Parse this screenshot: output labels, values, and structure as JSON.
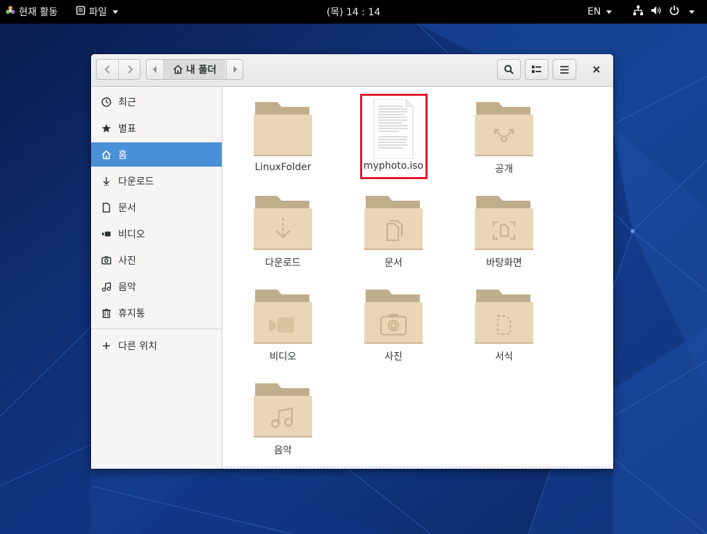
{
  "topbar": {
    "activities": "현재 활동",
    "app_name": "파일",
    "clock": "(목) 14 : 14",
    "language": "EN"
  },
  "window": {
    "breadcrumb_home": "내 폴더"
  },
  "sidebar": {
    "items": [
      {
        "label": "최근",
        "icon": "clock-icon"
      },
      {
        "label": "별표",
        "icon": "star-icon"
      },
      {
        "label": "홈",
        "icon": "home-icon"
      },
      {
        "label": "다운로드",
        "icon": "download-icon"
      },
      {
        "label": "문서",
        "icon": "document-icon"
      },
      {
        "label": "비디오",
        "icon": "video-icon"
      },
      {
        "label": "사진",
        "icon": "camera-icon"
      },
      {
        "label": "음악",
        "icon": "music-icon"
      },
      {
        "label": "휴지통",
        "icon": "trash-icon"
      }
    ],
    "other_locations": "다른 위치"
  },
  "files": [
    {
      "name": "LinuxFolder",
      "type": "folder"
    },
    {
      "name": "myphoto.iso",
      "type": "document"
    },
    {
      "name": "공개",
      "type": "folder-public"
    },
    {
      "name": "다운로드",
      "type": "folder-download"
    },
    {
      "name": "문서",
      "type": "folder-documents"
    },
    {
      "name": "바탕화면",
      "type": "folder-desktop"
    },
    {
      "name": "비디오",
      "type": "folder-video"
    },
    {
      "name": "사진",
      "type": "folder-pictures"
    },
    {
      "name": "서식",
      "type": "folder-templates"
    },
    {
      "name": "음악",
      "type": "folder-music"
    }
  ],
  "colors": {
    "sidebar_active": "#4a90d9",
    "selection_outline": "#e3182d",
    "folder_body": "#e8d6b6",
    "folder_tab": "#bfae8c"
  }
}
